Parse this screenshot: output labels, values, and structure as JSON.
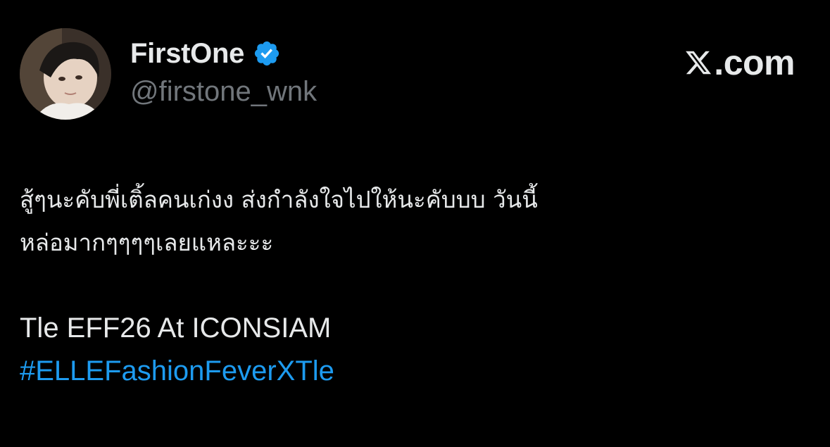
{
  "author": {
    "display_name": "FirstOne",
    "handle": "@firstone_wnk",
    "verified": true,
    "avatar_icon": "profile-photo"
  },
  "brand": {
    "label": ".com",
    "logo_icon": "x-logo-icon"
  },
  "tweet": {
    "line1": "สู้ๆนะคับพี่เติ้ลคนเก่งง ส่งกำลังใจไปให้นะคับบบ วันนี้",
    "line2": "หล่อมากๆๆๆๆเลยแหละะะ",
    "line3": "Tle EFF26 At ICONSIAM",
    "hashtag": "#ELLEFashionFeverXTle"
  },
  "colors": {
    "background": "#000000",
    "text_primary": "#e7e9ea",
    "text_secondary": "#71767b",
    "link": "#1d9bf0",
    "verified_badge": "#1d9bf0"
  }
}
